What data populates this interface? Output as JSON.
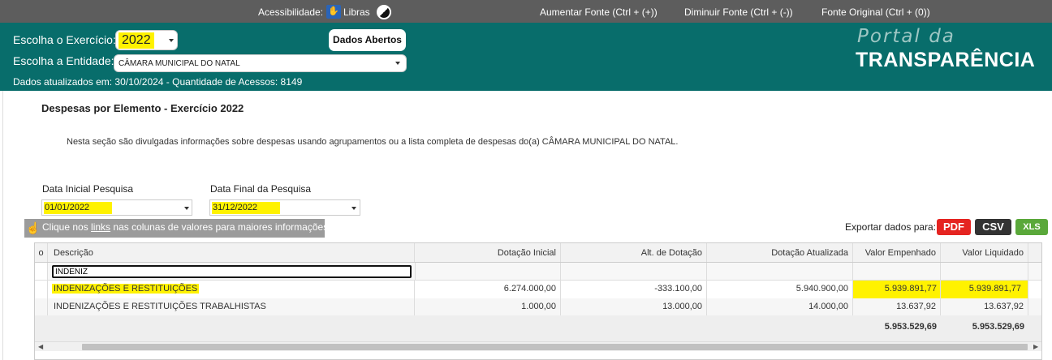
{
  "topbar": {
    "accessibility_label": "Acessibilidade:",
    "libras_label": "Libras",
    "increase_font": "Aumentar Fonte (Ctrl + (+))",
    "decrease_font": "Diminuir Fonte (Ctrl + (-))",
    "original_font": "Fonte Original (Ctrl + (0))"
  },
  "header": {
    "year_label": "Escolha o Exercício:",
    "year_value": "2022",
    "entity_label": "Escolha a Entidade:",
    "entity_value": "CÂMARA MUNICIPAL DO NATAL",
    "open_data_button": "Dados Abertos",
    "updated_text": "Dados atualizados em: 30/10/2024 - Quantidade de Acessos: 8149",
    "logo_line1": "Portal da",
    "logo_line2": "TRANSPARÊNCIA"
  },
  "page": {
    "title": "Despesas por Elemento - Exercício 2022",
    "description": "Nesta seção são divulgadas informações sobre despesas usando agrupamentos ou a lista completa de despesas do(a) CÂMARA MUNICIPAL DO NATAL.",
    "start_date_label": "Data Inicial Pesquisa",
    "start_date_value": "01/01/2022",
    "end_date_label": "Data Final da Pesquisa",
    "end_date_value": "31/12/2022",
    "hint_prefix": "Clique nos ",
    "hint_link": "links",
    "hint_suffix": " nas colunas de valores para maiores informações.",
    "export_label": "Exportar dados para:",
    "export_pdf": "PDF",
    "export_csv": "CSV",
    "export_xls": "XLS"
  },
  "grid": {
    "columns": [
      "o",
      "Descrição",
      "Dotação Inicial",
      "Alt. de Dotação",
      "Dotação Atualizada",
      "Valor Empenhado",
      "Valor Liquidado"
    ],
    "filter_value": "INDENIZ",
    "rows": [
      [
        "INDENIZAÇÕES E RESTITUIÇÕES",
        "6.274.000,00",
        "-333.100,00",
        "5.940.900,00",
        "5.939.891,77",
        "5.939.891,77"
      ],
      [
        "INDENIZAÇÕES E RESTITUIÇÕES TRABALHISTAS",
        "1.000,00",
        "13.000,00",
        "14.000,00",
        "13.637,92",
        "13.637,92"
      ]
    ],
    "totals": {
      "empenhado": "5.953.529,69",
      "liquidado": "5.953.529,69"
    }
  },
  "colors": {
    "header_bg": "#086d6b",
    "topbar_bg": "#5d5d5d",
    "highlight": "#fff200",
    "pdf": "#e52421",
    "csv": "#333333",
    "xls": "#5aa83a"
  },
  "icons": [
    "libras-icon",
    "contrast-icon",
    "hand-pointer-icon",
    "chevron-down-icon"
  ]
}
